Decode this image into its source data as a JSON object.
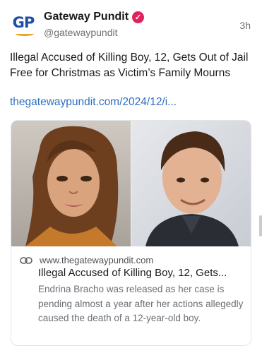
{
  "author": {
    "name": "Gateway Pundit",
    "handle": "@gatewaypundit",
    "avatar_text": "GP",
    "verified_icon": "check-badge-icon"
  },
  "post": {
    "time": "3h",
    "text": "Illegal Accused of Killing Boy, 12, Gets Out of Jail Free for Christmas as Victim’s Family Mourns",
    "link_text": "thegatewaypundit.com/2024/12/i..."
  },
  "card": {
    "domain": "www.thegatewaypundit.com",
    "title": "Illegal Accused of Killing Boy, 12, Gets...",
    "description": "Endrina Bracho was released as her case is pending almost a year after her actions allegedly caused the death of a 12-year-old boy.",
    "link_icon": "link-icon"
  },
  "colors": {
    "link": "#2f6fc0",
    "verified": "#e0245e",
    "brand_blue": "#1f4ea6",
    "brand_gold": "#e9a521"
  }
}
